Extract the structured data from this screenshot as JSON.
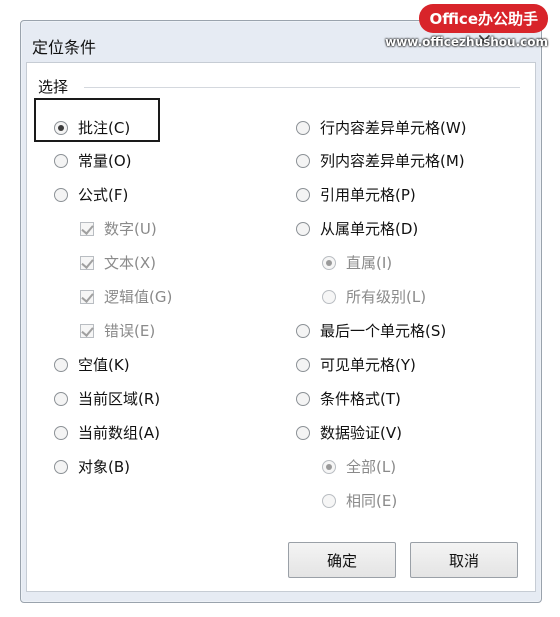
{
  "dialog": {
    "title": "定位条件",
    "close_glyph": "×"
  },
  "watermark": {
    "brand": "Office办公助手",
    "url": "www.officezhushou.com"
  },
  "group": {
    "label": "选择"
  },
  "left_options": [
    {
      "label": "批注(C)",
      "type": "radio",
      "checked": true,
      "disabled": false
    },
    {
      "label": "常量(O)",
      "type": "radio",
      "checked": false,
      "disabled": false
    },
    {
      "label": "公式(F)",
      "type": "radio",
      "checked": false,
      "disabled": false
    },
    {
      "label": "数字(U)",
      "type": "checkbox",
      "checked": true,
      "disabled": true
    },
    {
      "label": "文本(X)",
      "type": "checkbox",
      "checked": true,
      "disabled": true
    },
    {
      "label": "逻辑值(G)",
      "type": "checkbox",
      "checked": true,
      "disabled": true
    },
    {
      "label": "错误(E)",
      "type": "checkbox",
      "checked": true,
      "disabled": true
    },
    {
      "label": "空值(K)",
      "type": "radio",
      "checked": false,
      "disabled": false
    },
    {
      "label": "当前区域(R)",
      "type": "radio",
      "checked": false,
      "disabled": false
    },
    {
      "label": "当前数组(A)",
      "type": "radio",
      "checked": false,
      "disabled": false
    },
    {
      "label": "对象(B)",
      "type": "radio",
      "checked": false,
      "disabled": false
    }
  ],
  "right_options": [
    {
      "label": "行内容差异单元格(W)",
      "type": "radio",
      "checked": false,
      "disabled": false
    },
    {
      "label": "列内容差异单元格(M)",
      "type": "radio",
      "checked": false,
      "disabled": false
    },
    {
      "label": "引用单元格(P)",
      "type": "radio",
      "checked": false,
      "disabled": false
    },
    {
      "label": "从属单元格(D)",
      "type": "radio",
      "checked": false,
      "disabled": false
    },
    {
      "label": "直属(I)",
      "type": "radio",
      "checked": true,
      "disabled": true
    },
    {
      "label": "所有级别(L)",
      "type": "radio",
      "checked": false,
      "disabled": true
    },
    {
      "label": "最后一个单元格(S)",
      "type": "radio",
      "checked": false,
      "disabled": false
    },
    {
      "label": "可见单元格(Y)",
      "type": "radio",
      "checked": false,
      "disabled": false
    },
    {
      "label": "条件格式(T)",
      "type": "radio",
      "checked": false,
      "disabled": false
    },
    {
      "label": "数据验证(V)",
      "type": "radio",
      "checked": false,
      "disabled": false
    },
    {
      "label": "全部(L)",
      "type": "radio",
      "checked": true,
      "disabled": true
    },
    {
      "label": "相同(E)",
      "type": "radio",
      "checked": false,
      "disabled": true
    }
  ],
  "buttons": {
    "ok": "确定",
    "cancel": "取消"
  }
}
